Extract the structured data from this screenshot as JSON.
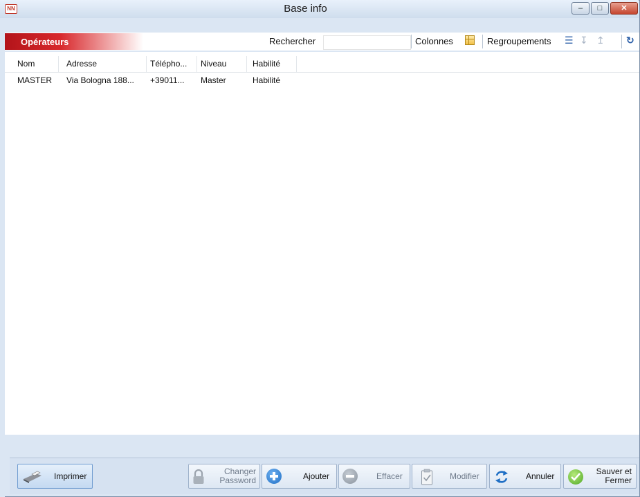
{
  "window": {
    "title": "Base info",
    "icon_text": "NN"
  },
  "window_controls": {
    "minimize": "–",
    "maximize": "□",
    "close": "✕"
  },
  "section": {
    "title": "Opérateurs"
  },
  "toolbar": {
    "search_label": "Rechercher",
    "search_value": "",
    "columns_label": "Colonnes",
    "grouping_label": "Regroupements",
    "icons": {
      "list": "☰",
      "sort_asc": "↧",
      "sort_desc": "↥",
      "refresh": "↻"
    }
  },
  "table": {
    "columns": [
      "Nom",
      "Adresse",
      "Télépho...",
      "Niveau",
      "Habilité"
    ],
    "rows": [
      [
        "MASTER",
        "Via Bologna 188...",
        "+39011...",
        "Master",
        "Habilité"
      ]
    ]
  },
  "footer": {
    "print": "Imprimer",
    "change_password_1": "Changer",
    "change_password_2": "Password",
    "add": "Ajouter",
    "delete": "Effacer",
    "modify": "Modifier",
    "cancel": "Annuler",
    "save_close_1": "Sauver et",
    "save_close_2": "Fermer"
  },
  "colors": {
    "accent_red": "#c0161c",
    "window_bg": "#dbe6f3",
    "add_blue": "#1f6fc5",
    "save_green": "#5cb531"
  }
}
